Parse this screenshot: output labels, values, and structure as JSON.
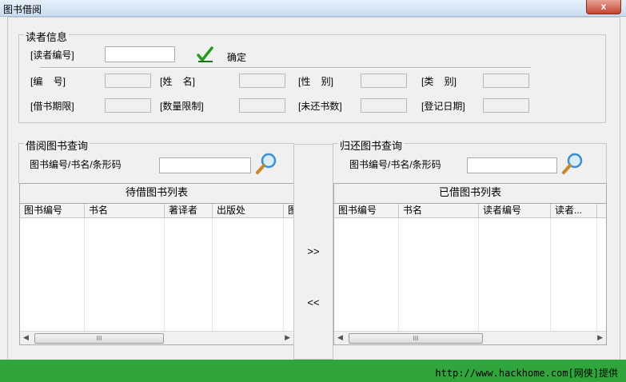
{
  "window": {
    "title": "图书借阅",
    "close_label": "x"
  },
  "reader_info": {
    "legend": "读者信息",
    "id_label": "[读者编号]",
    "id_value": "",
    "confirm_label": "确定",
    "row1": [
      {
        "label": "[编    号]",
        "value": ""
      },
      {
        "label": "[姓    名]",
        "value": ""
      },
      {
        "label": "[性    别]",
        "value": ""
      },
      {
        "label": "[类    别]",
        "value": ""
      }
    ],
    "row2": [
      {
        "label": "[借书期限]",
        "value": ""
      },
      {
        "label": "[数量限制]",
        "value": ""
      },
      {
        "label": "[未还书数]",
        "value": ""
      },
      {
        "label": "[登记日期]",
        "value": ""
      }
    ]
  },
  "borrow_query": {
    "legend": "借阅图书查询",
    "search_label": "图书编号/书名/条形码",
    "search_value": ""
  },
  "return_query": {
    "legend": "归还图书查询",
    "search_label": "图书编号/书名/条形码",
    "search_value": ""
  },
  "pending_list": {
    "title": "待借图书列表",
    "columns": [
      "图书编号",
      "书名",
      "著译者",
      "出版处",
      "图"
    ],
    "scroll_label": "III"
  },
  "borrowed_list": {
    "title": "已借图书列表",
    "columns": [
      "图书编号",
      "书名",
      "读者编号",
      "读者...",
      ""
    ],
    "scroll_label": "III"
  },
  "transfer": {
    "right_label": ">>",
    "left_label": "<<"
  },
  "status": {
    "credit": "http://www.hackhome.com[网侠]提供"
  },
  "colors": {
    "status_bar": "#2fa53b",
    "check": "#2a9a1f"
  }
}
